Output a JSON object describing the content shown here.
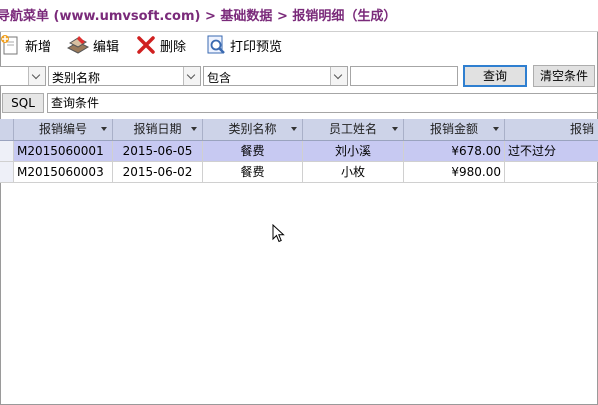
{
  "breadcrumb": {
    "text": "导航菜单 (www.umvsoft.com) > 基础数据 > 报销明细（生成）"
  },
  "toolbar": {
    "add_label": "新增",
    "edit_label": "编辑",
    "delete_label": "删除",
    "print_preview_label": "打印预览"
  },
  "filter": {
    "field_select_value": "类别名称",
    "operator_select_value": "包含",
    "search_value": "",
    "query_label": "查询",
    "clear_label": "清空条件"
  },
  "sql": {
    "label": "SQL",
    "value": "查询条件"
  },
  "grid": {
    "columns": [
      "报销编号",
      "报销日期",
      "类别名称",
      "员工姓名",
      "报销金额",
      "报销"
    ],
    "rows": [
      {
        "code": "M2015060001",
        "date": "2015-06-05",
        "category": "餐费",
        "employee": "刘小溪",
        "amount": "¥678.00",
        "note": "过不过分"
      },
      {
        "code": "M2015060003",
        "date": "2015-06-02",
        "category": "餐费",
        "employee": "小枚",
        "amount": "¥980.00",
        "note": ""
      }
    ]
  },
  "colors": {
    "breadcrumb_text": "#7a2a7a",
    "header_bg": "#cdd3e8",
    "selected_row_bg": "#c7c9f2",
    "query_button_border": "#2f7fd0"
  }
}
